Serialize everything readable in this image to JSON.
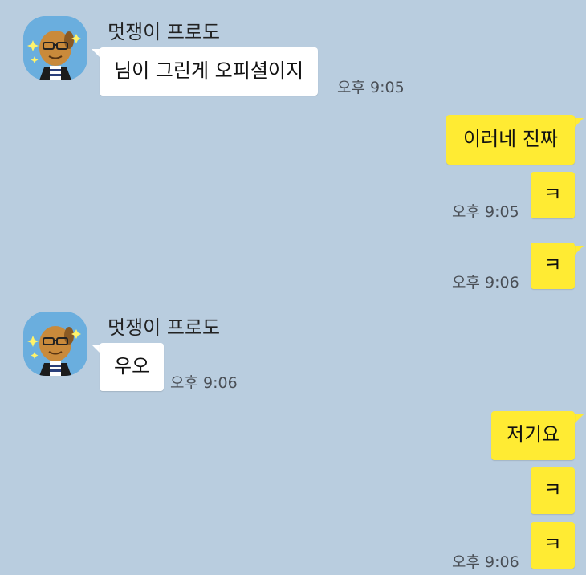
{
  "colors": {
    "background": "#b9cddf",
    "incoming_bubble": "#ffffff",
    "outgoing_bubble": "#ffeb33",
    "avatar_bg": "#6aaede"
  },
  "groups": [
    {
      "sender": "멋쟁이 프로도",
      "avatar_icon": "frodo-character-avatar-icon",
      "messages": [
        {
          "text": "님이 그린게 오피셜이지",
          "time": "오후 9:05"
        }
      ]
    },
    {
      "sender": "me",
      "messages": [
        {
          "text": "이러네 진짜"
        },
        {
          "text": "ㅋ",
          "time": "오후 9:05"
        },
        {
          "text": "ㅋ",
          "time": "오후 9:06"
        }
      ]
    },
    {
      "sender": "멋쟁이 프로도",
      "avatar_icon": "frodo-character-avatar-icon",
      "messages": [
        {
          "text": "우오",
          "time": "오후 9:06"
        }
      ]
    },
    {
      "sender": "me",
      "messages": [
        {
          "text": "저기요"
        },
        {
          "text": "ㅋ"
        },
        {
          "text": "ㅋ",
          "time": "오후 9:06"
        }
      ]
    }
  ]
}
